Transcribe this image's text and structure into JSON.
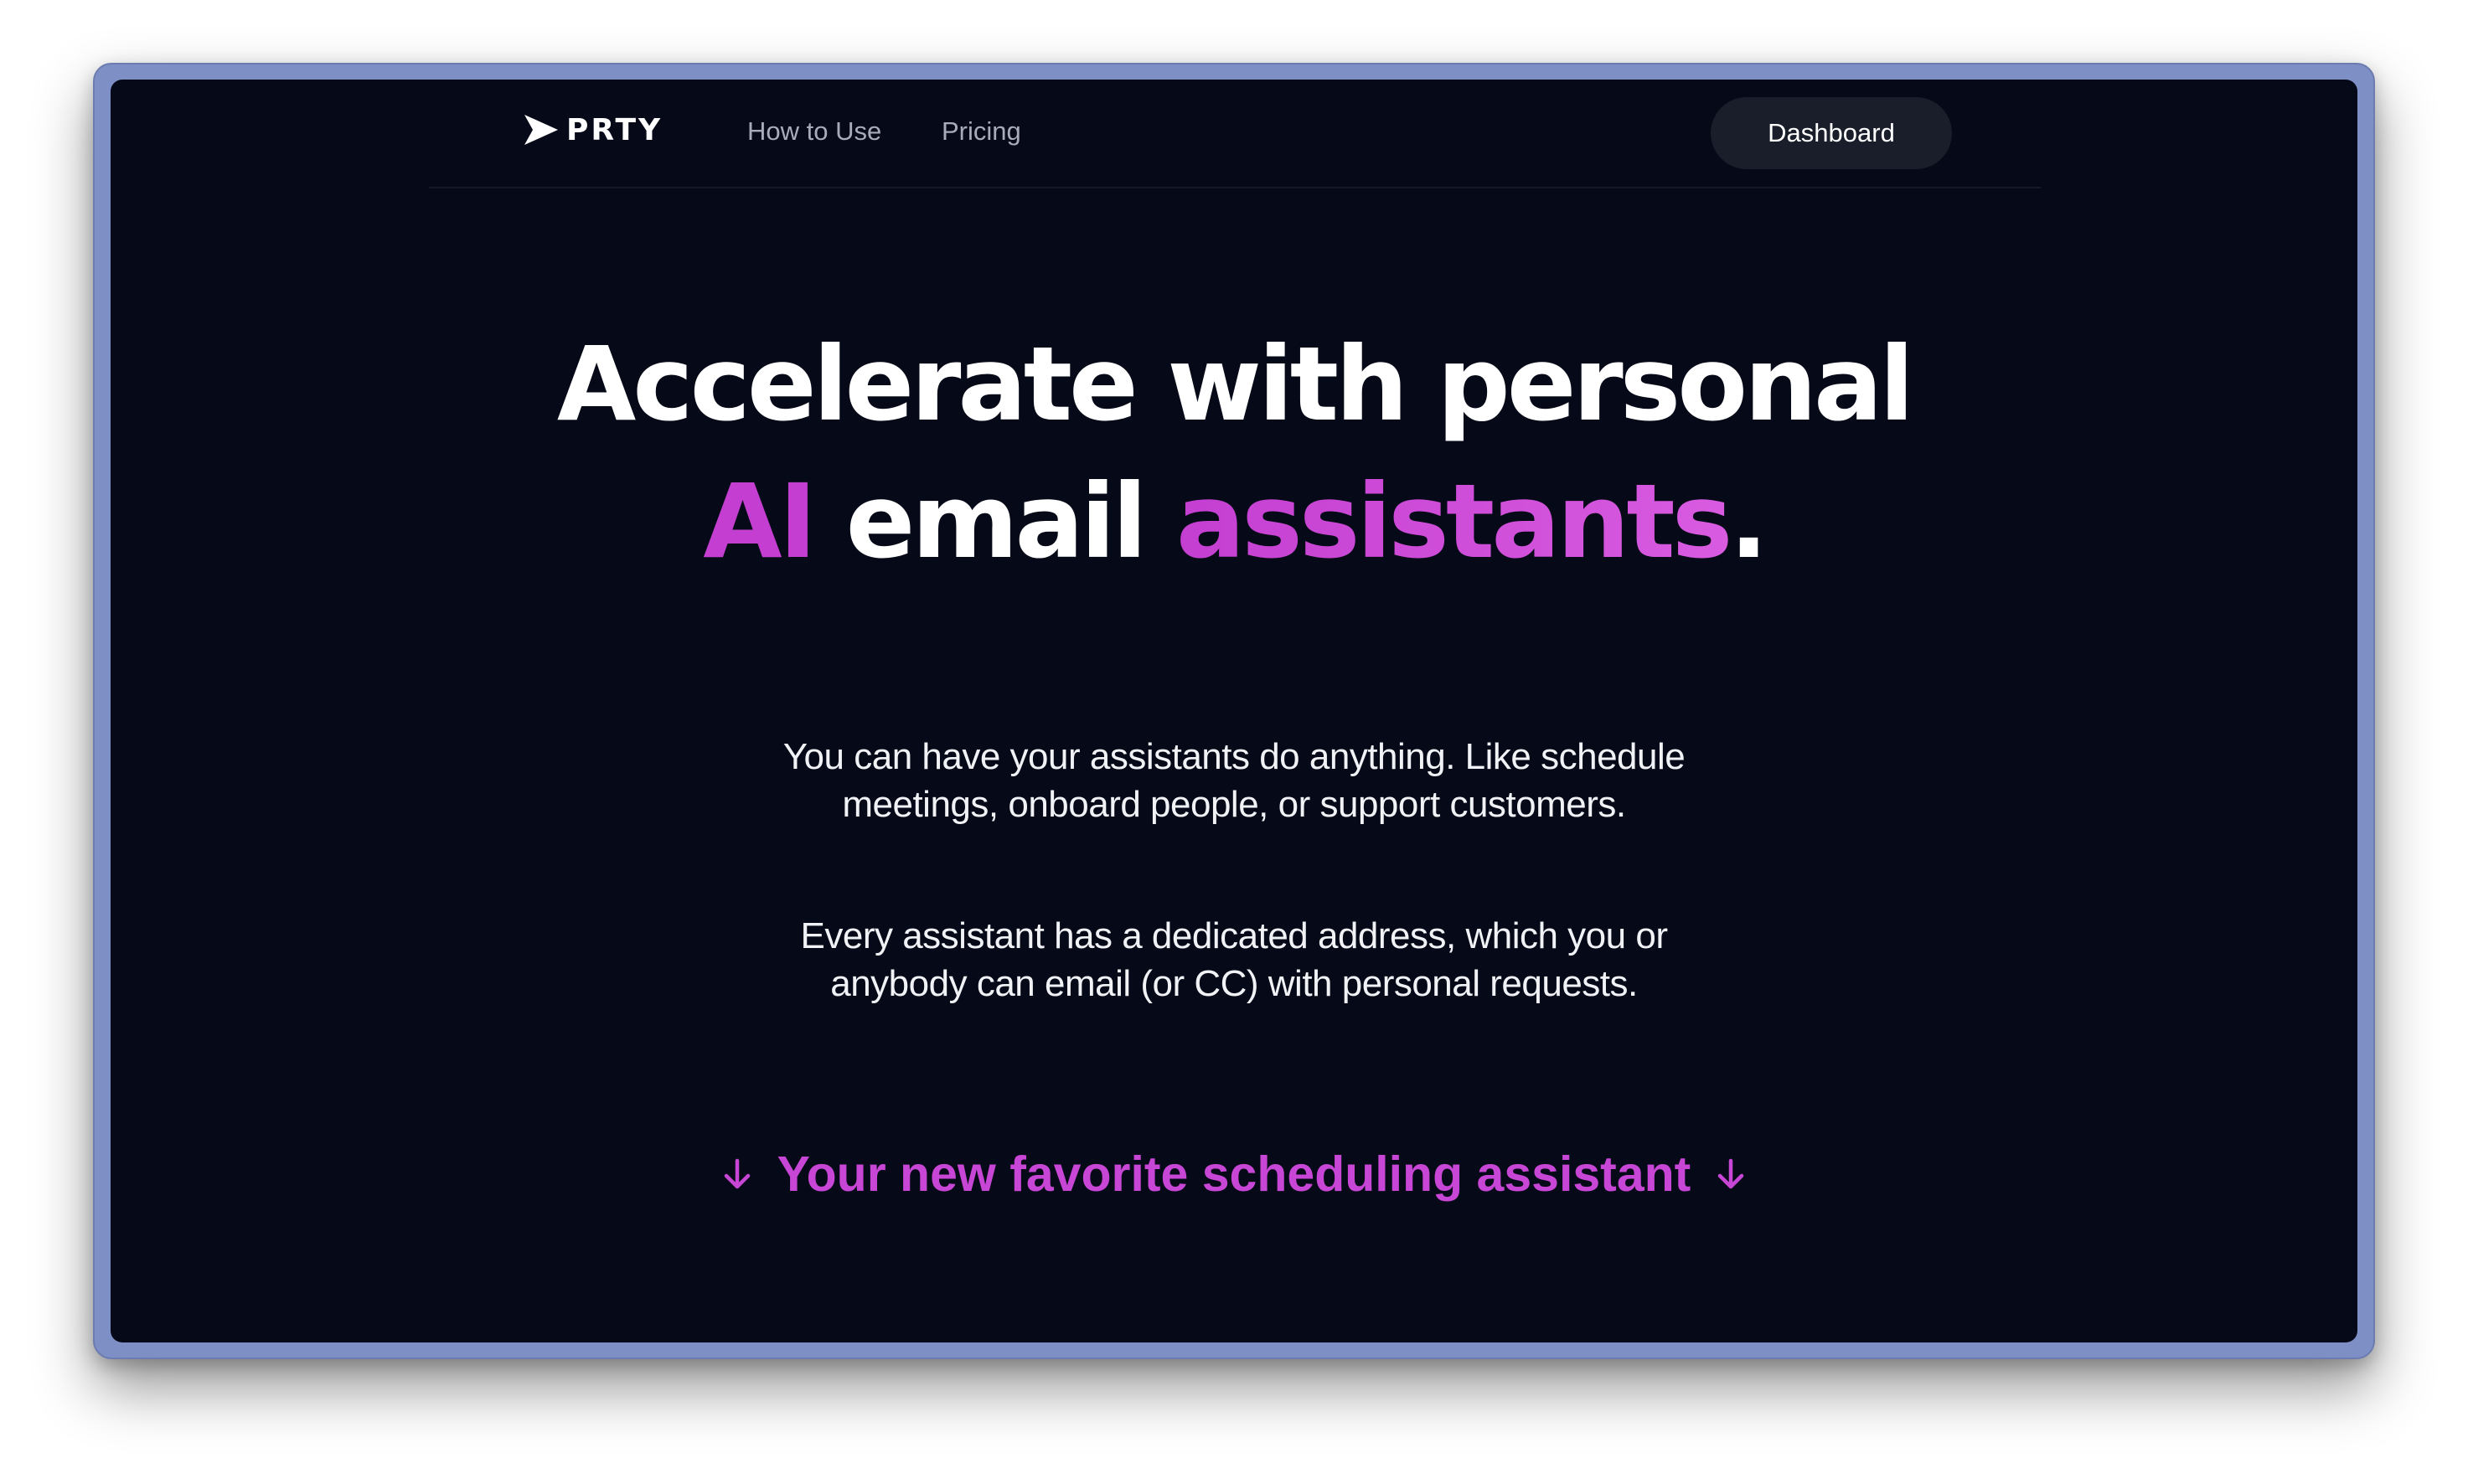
{
  "brand": {
    "name": "PRTY",
    "logo_icon": "send-arrow-icon"
  },
  "nav": {
    "links": [
      {
        "label": "How to Use"
      },
      {
        "label": "Pricing"
      }
    ],
    "dashboard_label": "Dashboard"
  },
  "hero": {
    "title_line1": "Accelerate with personal",
    "title_ai": "AI",
    "title_email": " email ",
    "title_assistants": "assistants",
    "title_period": ".",
    "paragraph1": "You can have your assistants do anything. Like schedule meetings, onboard people, or support customers.",
    "paragraph2": "Every assistant has a dedicated address, which you or anybody can email (or CC) with personal requests.",
    "cta_label": "Your new favorite scheduling assistant",
    "cta_icon": "arrow-down-icon"
  },
  "colors": {
    "background": "#060a18",
    "accent": "#c43fd1",
    "window_frame": "#7d8fc4",
    "button_bg": "#1a1e2b"
  }
}
